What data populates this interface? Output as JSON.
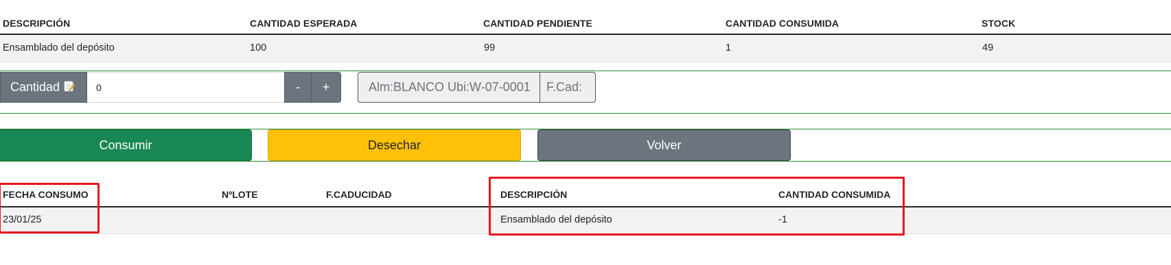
{
  "top_table": {
    "headers": [
      "DESCRIPCIÓN",
      "CANTIDAD ESPERADA",
      "CANTIDAD PENDIENTE",
      "CANTIDAD CONSUMIDA",
      "STOCK"
    ],
    "rows": [
      [
        "Ensamblado del depósito",
        "100",
        "99",
        "1",
        "49"
      ]
    ]
  },
  "quantity_group": {
    "label": "Cantidad",
    "label_icon": "edit-note-icon",
    "value": "0",
    "minus_label": "-",
    "plus_label": "+"
  },
  "location_field": "Alm:BLANCO Ubi:W-07-0001",
  "expiry_field": "F.Cad:",
  "actions": {
    "consume": "Consumir",
    "discard": "Desechar",
    "back": "Volver"
  },
  "history_table": {
    "headers": [
      "FECHA CONSUMO",
      "NºLOTE",
      "F.CADUCIDAD",
      "DESCRIPCIÓN",
      "CANTIDAD CONSUMIDA"
    ],
    "rows": [
      [
        "23/01/25",
        "",
        "",
        "Ensamblado del depósito",
        "-1"
      ]
    ]
  },
  "colors": {
    "consume": "#198754",
    "discard": "#ffc107",
    "back": "#6c757d",
    "highlight_box": "#e8141e",
    "separator": "#2e8b2e"
  }
}
